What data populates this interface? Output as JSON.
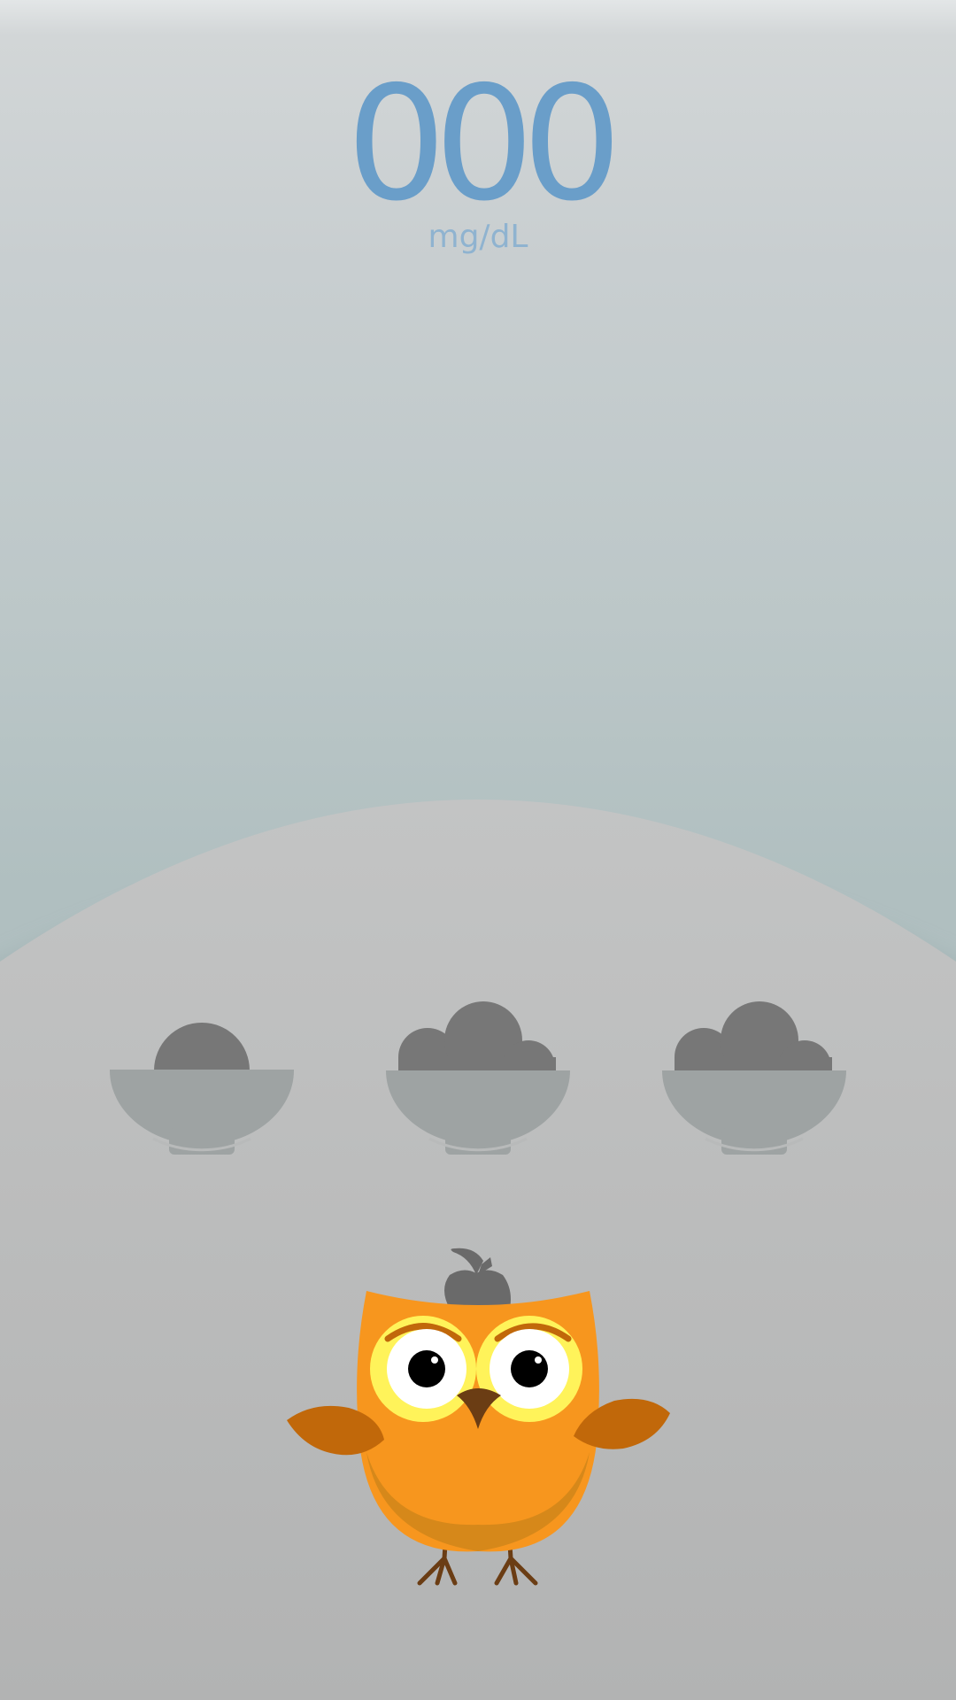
{
  "glucose": {
    "value": "000",
    "unit": "mg/dL"
  },
  "colors": {
    "reading": "#6a9ec9",
    "unit": "#8fb3d0",
    "ground": "#bdbdbd",
    "bowl": "#9ea3a3",
    "food": "#777777",
    "owl_body": "#f7961e",
    "owl_wing": "#c1680a",
    "owl_eye_ring": "#fff35a",
    "owl_beak": "#6b3d14"
  },
  "bowls": [
    {
      "label": "bowl-left",
      "fill_level": "low"
    },
    {
      "label": "bowl-middle",
      "fill_level": "full"
    },
    {
      "label": "bowl-right",
      "fill_level": "full"
    }
  ]
}
